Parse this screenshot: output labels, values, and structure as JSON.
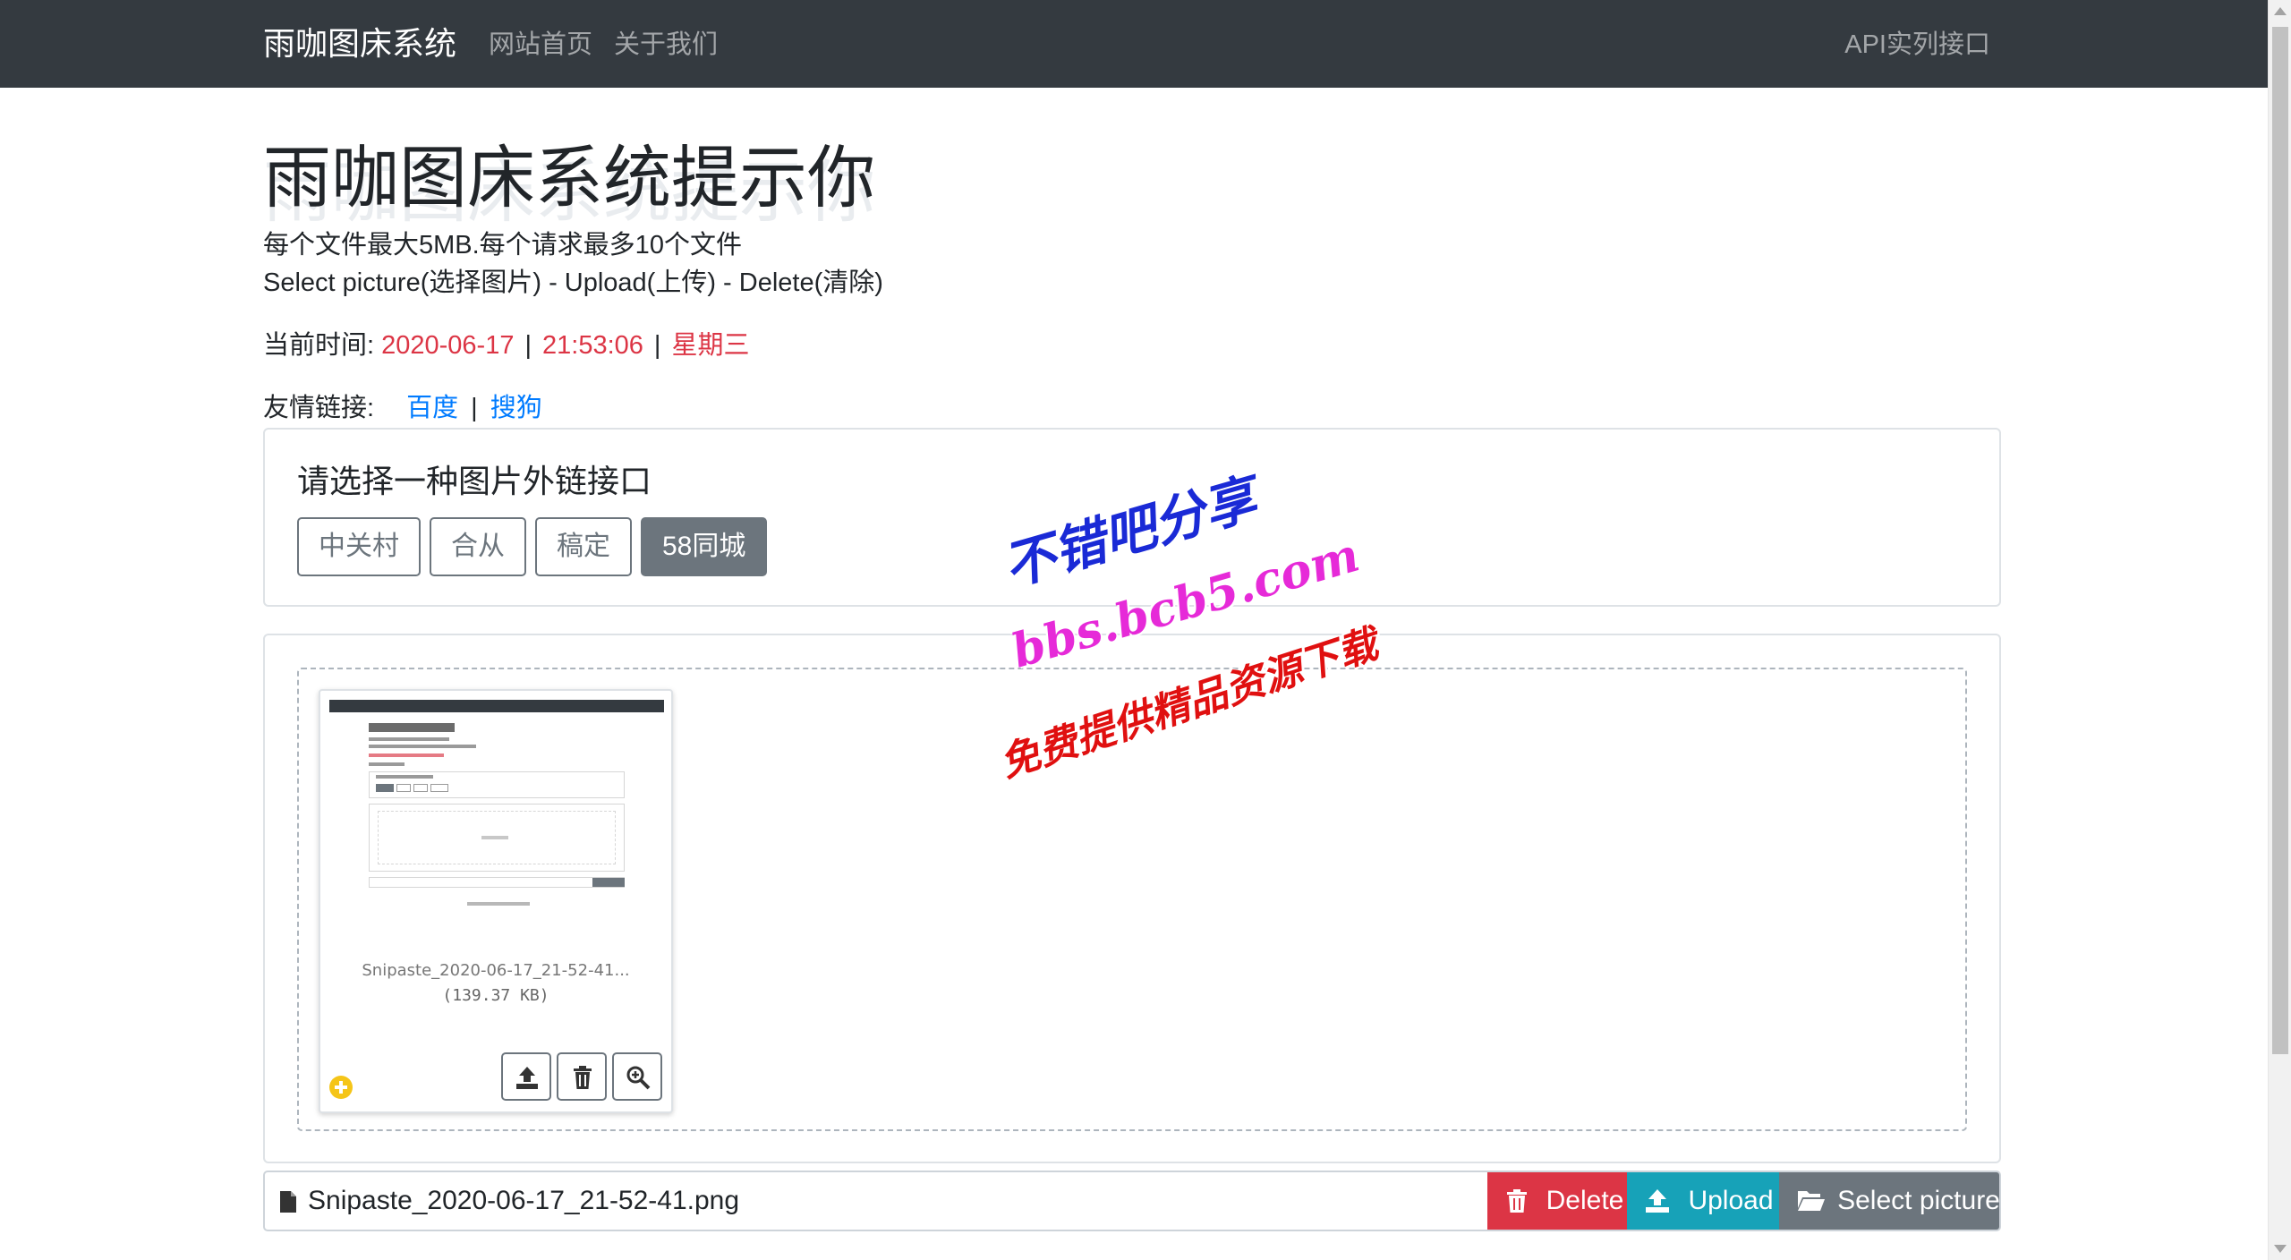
{
  "navbar": {
    "brand": "雨咖图床系统",
    "home": "网站首页",
    "about": "关于我们",
    "api": "API实列接口"
  },
  "header": {
    "title": "雨咖图床系统提示你",
    "limit_line": "每个文件最大5MB.每个请求最多10个文件",
    "steps_line": "Select picture(选择图片) - Upload(上传) - Delete(清除)",
    "time_label": "当前时间:",
    "date": "2020-06-17",
    "time": "21:53:06",
    "weekday": "星期三",
    "separator": "|",
    "links_label": "友情链接:",
    "links": [
      "百度",
      "搜狗"
    ]
  },
  "interface_card": {
    "title": "请选择一种图片外链接口",
    "options": [
      "中关村",
      "合从",
      "稿定",
      "58同城"
    ],
    "selected": "58同城"
  },
  "preview": {
    "file_name": "Snipaste_2020-06-17_21-52-41...",
    "file_size": "(139.37 KB)"
  },
  "file_bar": {
    "file_name": "Snipaste_2020-06-17_21-52-41.png",
    "delete_label": "Delete",
    "upload_label": "Upload",
    "select_label": "Select picture"
  },
  "watermark": {
    "line1": "不错吧分享",
    "line2": "bbs.bcb5.com",
    "line3": "免费提供精品资源下载"
  },
  "colors": {
    "navbar": "#343a40",
    "danger": "#dc3545",
    "info": "#17a2b8",
    "secondary": "#6c757d",
    "link": "#007bff"
  }
}
